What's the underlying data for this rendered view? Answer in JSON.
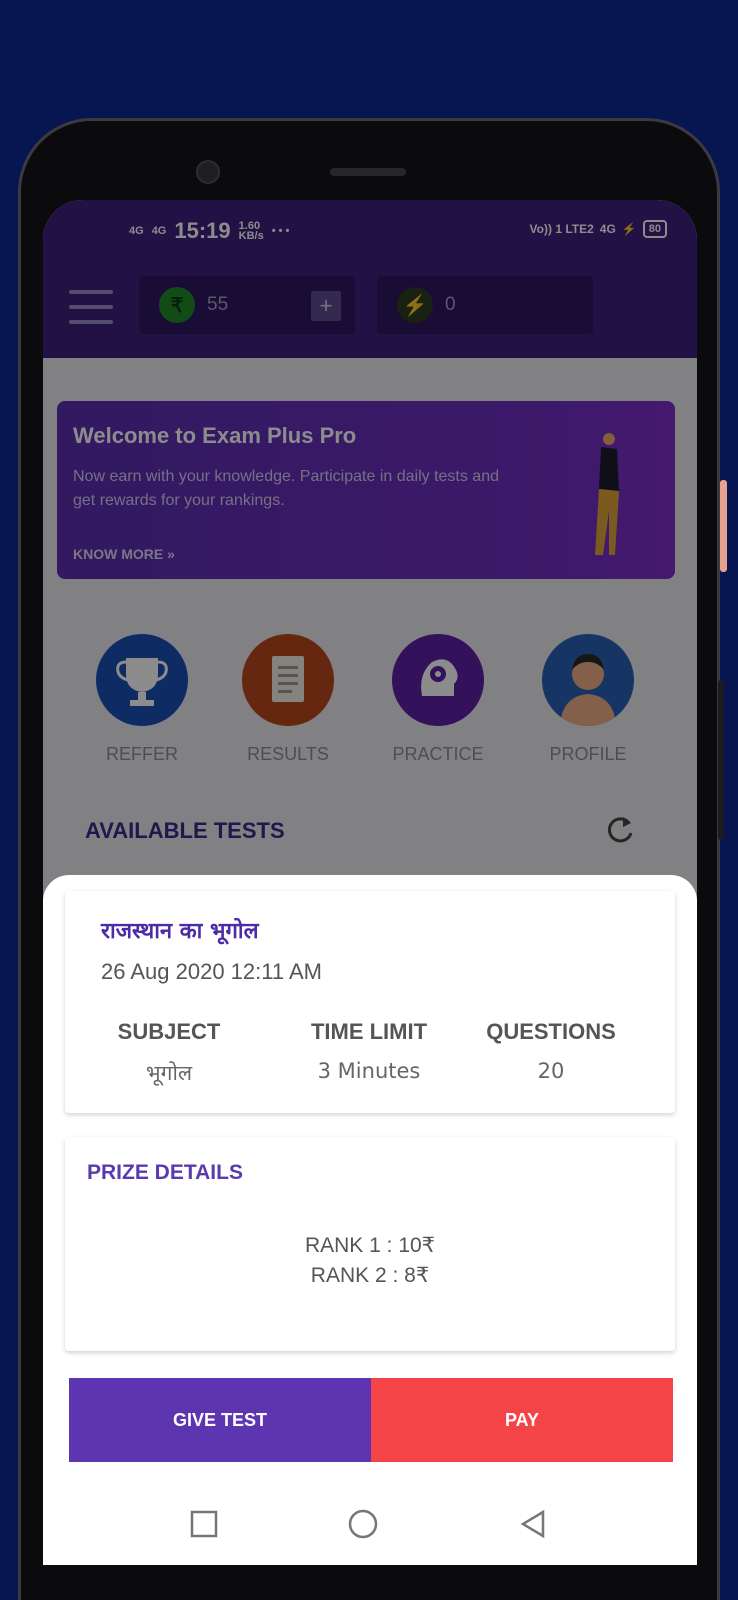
{
  "status_bar": {
    "signal_1": "4G",
    "signal_2": "4G",
    "time": "15:19",
    "speed_value": "1.60",
    "speed_unit": "KB/s",
    "vo_lte": "Vo)) 1 LTE2",
    "network": "4G",
    "battery": "80"
  },
  "app_bar": {
    "coins_value": "55",
    "coins_icon": "rupee-coin-icon",
    "add_label": "+",
    "energy_value": "0",
    "energy_icon": "lightning-icon"
  },
  "banner": {
    "title": "Welcome to Exam Plus Pro",
    "text": "Now earn with your knowledge. Participate in daily tests and get rewards for your rankings.",
    "link": "KNOW MORE »"
  },
  "categories": [
    {
      "label": "REFFER",
      "icon": "trophy-icon",
      "color": "#1b4fb7"
    },
    {
      "label": "RESULTS",
      "icon": "document-icon",
      "color": "#b8481d"
    },
    {
      "label": "PRACTICE",
      "icon": "brain-gear-icon",
      "color": "#5e1fa6"
    },
    {
      "label": "PROFILE",
      "icon": "person-avatar-icon",
      "color": "#2a62b7"
    }
  ],
  "available_tests": {
    "heading": "AVAILABLE TESTS"
  },
  "test": {
    "title": "राजस्थान का भूगोल",
    "date": "26 Aug 2020 12:11 AM",
    "subject_label": "SUBJECT",
    "subject_value": "भूगोल",
    "time_label": "TIME LIMIT",
    "time_value": "3 Minutes",
    "questions_label": "QUESTIONS",
    "questions_value": "20"
  },
  "prize": {
    "heading": "PRIZE DETAILS",
    "ranks": [
      "RANK 1 : 10₹",
      "RANK 2 : 8₹"
    ]
  },
  "actions": {
    "give_test": "GIVE TEST",
    "pay": "PAY"
  },
  "colors": {
    "purple": "#5e35b1",
    "red": "#f44447",
    "page_bg": "#071650"
  }
}
